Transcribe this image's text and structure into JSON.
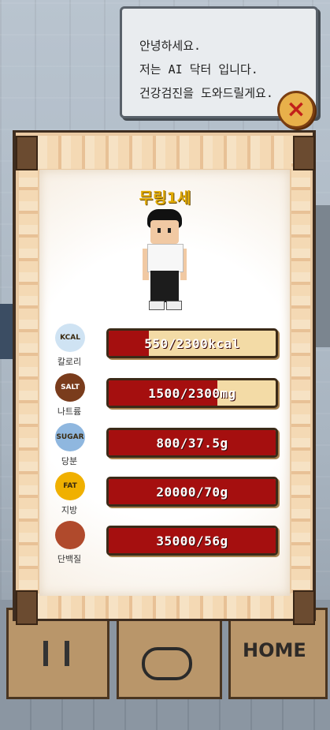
{
  "bubble": {
    "lines": "안녕하세요.\n저는 AI 닥터 입니다.\n건강검진을 도와드릴게요."
  },
  "close_icon": "×",
  "character": {
    "name": "무링1세"
  },
  "stats": [
    {
      "label": "칼로리",
      "icon": "KCAL",
      "value_text": "550/2300kcal",
      "fill_fraction": 0.24,
      "icon_color": "#cfe3f3"
    },
    {
      "label": "나트륨",
      "icon": "SALT",
      "value_text": "1500/2300mg",
      "fill_fraction": 0.65,
      "icon_color": "#7a3c1c"
    },
    {
      "label": "당분",
      "icon": "SUGAR",
      "value_text": "800/37.5g",
      "fill_fraction": 1.0,
      "icon_color": "#8fb7df"
    },
    {
      "label": "지방",
      "icon": "FAT",
      "value_text": "20000/70g",
      "fill_fraction": 1.0,
      "icon_color": "#f0b000"
    },
    {
      "label": "단백질",
      "icon": "meat-icon",
      "value_text": "35000/56g",
      "fill_fraction": 1.0,
      "icon_color": "#b04a2c"
    }
  ],
  "bottom": {
    "home_label": "HOME"
  },
  "colors": {
    "bar_fill": "#a50f0f",
    "bar_bg": "#f3dba6",
    "name_color": "#e0a900"
  }
}
